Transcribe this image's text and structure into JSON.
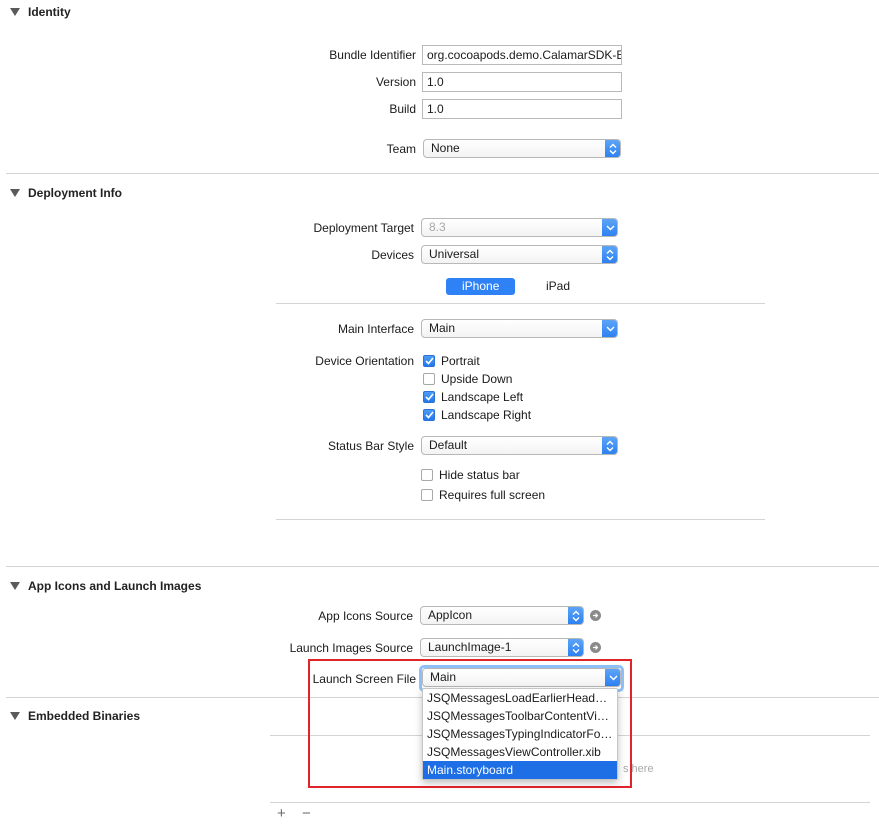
{
  "identity": {
    "title": "Identity",
    "bundle_identifier_label": "Bundle Identifier",
    "bundle_identifier_value": "org.cocoapods.demo.CalamarSDK-E",
    "version_label": "Version",
    "version_value": "1.0",
    "build_label": "Build",
    "build_value": "1.0",
    "team_label": "Team",
    "team_value": "None"
  },
  "deployment": {
    "title": "Deployment Info",
    "deployment_target_label": "Deployment Target",
    "deployment_target_value": "8.3",
    "devices_label": "Devices",
    "devices_value": "Universal",
    "segments": [
      "iPhone",
      "iPad"
    ],
    "main_interface_label": "Main Interface",
    "main_interface_value": "Main",
    "device_orientation_label": "Device Orientation",
    "orientations": [
      {
        "label": "Portrait",
        "checked": true
      },
      {
        "label": "Upside Down",
        "checked": false
      },
      {
        "label": "Landscape Left",
        "checked": true
      },
      {
        "label": "Landscape Right",
        "checked": true
      }
    ],
    "status_bar_style_label": "Status Bar Style",
    "status_bar_style_value": "Default",
    "hide_status_bar_label": "Hide status bar",
    "requires_full_screen_label": "Requires full screen"
  },
  "app_icons": {
    "title": "App Icons and Launch Images",
    "app_icons_source_label": "App Icons Source",
    "app_icons_source_value": "AppIcon",
    "launch_images_source_label": "Launch Images Source",
    "launch_images_source_value": "LaunchImage-1",
    "launch_screen_file_label": "Launch Screen File",
    "launch_screen_file_value": "Main"
  },
  "launch_menu": {
    "items": [
      "JSQMessagesLoadEarlierHeader…",
      "JSQMessagesToolbarContentVie…",
      "JSQMessagesTypingIndicatorFo…",
      "JSQMessagesViewController.xib",
      "Main.storyboard"
    ],
    "selected_index": 4
  },
  "embedded": {
    "title": "Embedded Binaries",
    "placeholder_fragment": "s here",
    "add_symbol": "+",
    "remove_symbol": "−"
  },
  "colors": {
    "accent": "#2f82f5",
    "highlight_box": "#e0242a"
  }
}
